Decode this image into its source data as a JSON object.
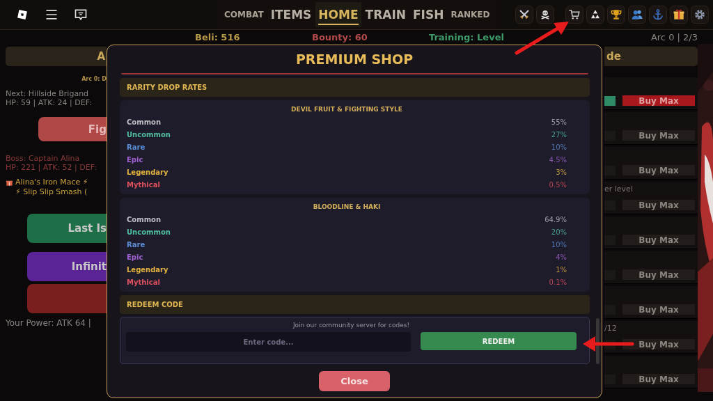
{
  "top_bar": {
    "nav": [
      {
        "label": "COMBAT",
        "kind": "minor",
        "selected": false
      },
      {
        "label": "ITEMS",
        "kind": "major",
        "selected": false
      },
      {
        "label": "HOME",
        "kind": "major",
        "selected": true
      },
      {
        "label": "TRAIN",
        "kind": "major",
        "selected": false
      },
      {
        "label": "FISH",
        "kind": "major",
        "selected": false
      },
      {
        "label": "RANKED",
        "kind": "minor",
        "selected": false
      }
    ]
  },
  "stats": [
    {
      "text": "Beli: 516",
      "color": "#b89a4a"
    },
    {
      "text": "Bounty: 60",
      "color": "#b24a4a"
    },
    {
      "text": "Training: Level",
      "color": "#3f9a6a"
    }
  ],
  "arc_progress": "Arc 0 | 2/3",
  "left_panel": {
    "header": "A",
    "arc": "Arc 0: D",
    "next_enemy": "Next: Hillside Brigand",
    "next_stats": "HP: 59 | ATK: 24 | DEF:",
    "fight_button": "Fig",
    "boss": "Boss: Captain Alina",
    "boss_stats": "HP: 221 | ATK: 52 | DEF:",
    "reward_lines": [
      "Alina's Iron Mace ⚡",
      "⚡ Slip Slip Smash ("
    ],
    "buttons": [
      {
        "label": "Last Is",
        "color": "#1e6e48"
      },
      {
        "label": "Infinit",
        "color": "#5a2496"
      },
      {
        "color": "#7a1e1e"
      }
    ],
    "power": "Your Power: ATK 64 |"
  },
  "right_panel": {
    "header": "de",
    "rows": [
      {
        "button": "Buy Max",
        "highlight": true
      },
      {
        "button": "Buy Max",
        "highlight": false
      },
      {
        "button": "Buy Max",
        "highlight": false
      },
      {
        "note": "er level",
        "button": "Buy Max",
        "highlight": false
      },
      {
        "button": "Buy Max",
        "highlight": false
      },
      {
        "button": "Buy Max",
        "highlight": false
      },
      {
        "button": "Buy Max",
        "highlight": false
      },
      {
        "note": "/12",
        "button": "Buy Max",
        "highlight": false
      },
      {
        "button": "Buy Max",
        "highlight": false
      }
    ]
  },
  "modal": {
    "title": "PREMIUM SHOP",
    "rates_heading": "RARITY DROP RATES",
    "rate_tables": [
      {
        "title": "DEVIL FRUIT & FIGHTING STYLE",
        "rows": [
          {
            "rarity": "Common",
            "rate": "55%",
            "color": "#bdbdc4"
          },
          {
            "rarity": "Uncommon",
            "rate": "27%",
            "color": "#4fbfa0"
          },
          {
            "rarity": "Rare",
            "rate": "10%",
            "color": "#5b8ed6"
          },
          {
            "rarity": "Epic",
            "rate": "4.5%",
            "color": "#a061d2"
          },
          {
            "rarity": "Legendary",
            "rate": "3%",
            "color": "#e2b23f"
          },
          {
            "rarity": "Mythical",
            "rate": "0.5%",
            "color": "#e0505e"
          }
        ]
      },
      {
        "title": "BLOODLINE & HAKI",
        "rows": [
          {
            "rarity": "Common",
            "rate": "64.9%",
            "color": "#bdbdc4"
          },
          {
            "rarity": "Uncommon",
            "rate": "20%",
            "color": "#4fbfa0"
          },
          {
            "rarity": "Rare",
            "rate": "10%",
            "color": "#5b8ed6"
          },
          {
            "rarity": "Epic",
            "rate": "4%",
            "color": "#a061d2"
          },
          {
            "rarity": "Legendary",
            "rate": "1%",
            "color": "#e2b23f"
          },
          {
            "rarity": "Mythical",
            "rate": "0.1%",
            "color": "#e0505e"
          }
        ]
      }
    ],
    "redeem": {
      "heading": "REDEEM CODE",
      "hint": "Join our community server for codes!",
      "placeholder": "Enter code...",
      "button": "REDEEM"
    },
    "close_button": "Close"
  }
}
